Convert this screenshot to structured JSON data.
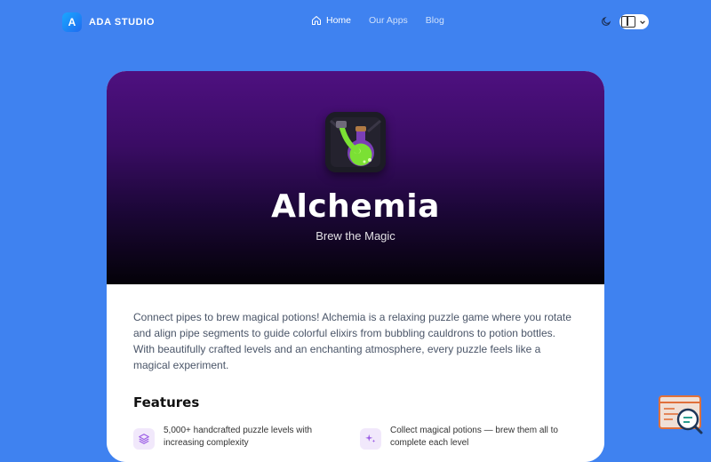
{
  "brand": {
    "mark": "A",
    "name": "ADA STUDIO"
  },
  "nav": {
    "items": [
      {
        "label": "Home",
        "active": true,
        "icon": "home-icon"
      },
      {
        "label": "Our Apps",
        "active": false
      },
      {
        "label": "Blog",
        "active": false
      }
    ]
  },
  "header_controls": {
    "theme_icon": "moon-icon",
    "device_icon": "device-icon"
  },
  "app": {
    "title": "Alchemia",
    "tagline": "Brew the Magic",
    "icon": "potion-icon",
    "description": "Connect pipes to brew magical potions! Alchemia is a relaxing puzzle game where you rotate and align pipe segments to guide colorful elixirs from bubbling cauldrons to potion bottles. With beautifully crafted levels and an enchanting atmosphere, every puzzle feels like a magical experiment."
  },
  "features": {
    "heading": "Features",
    "items": [
      {
        "text": "5,000+ handcrafted puzzle levels with increasing complexity",
        "icon": "layers-icon"
      },
      {
        "text": "Collect magical potions — brew them all to complete each level",
        "icon": "sparkles-icon"
      }
    ]
  },
  "colors": {
    "page_bg": "#3f82f0",
    "hero_top": "#4e1080",
    "hero_bottom": "#040208",
    "accent": "#9b5de5",
    "potion_green": "#7be034"
  }
}
